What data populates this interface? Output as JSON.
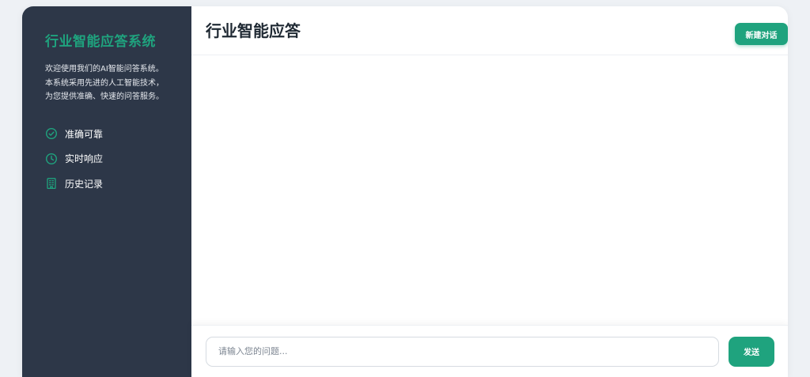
{
  "colors": {
    "accent": "#1fa37e",
    "sidebar_bg": "#2d3748",
    "page_bg": "#eef1f5"
  },
  "sidebar": {
    "brand": "行业智能应答系统",
    "intro_lines": [
      "欢迎使用我们的AI智能问答系统。",
      "本系统采用先进的人工智能技术，",
      "为您提供准确、快速的问答服务。"
    ],
    "features": [
      {
        "icon": "check-circle-icon",
        "label": "准确可靠"
      },
      {
        "icon": "clock-icon",
        "label": "实时响应"
      },
      {
        "icon": "building-icon",
        "label": "历史记录"
      }
    ]
  },
  "header": {
    "title": "行业智能应答",
    "new_chat_label": "新建对话"
  },
  "composer": {
    "placeholder": "请输入您的问题...",
    "value": "",
    "send_label": "发送"
  }
}
